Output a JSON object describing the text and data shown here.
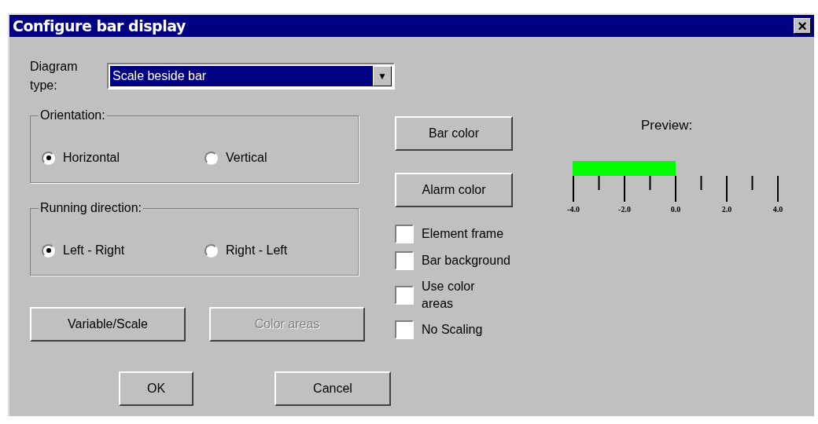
{
  "window": {
    "title": "Configure bar display",
    "close": "×"
  },
  "diagram_type": {
    "label": "Diagram type:",
    "value": "Scale beside bar",
    "arrow": "▼"
  },
  "groups": [
    {
      "title": "Orientation:",
      "options": [
        {
          "label": "Horizontal",
          "selected": true
        },
        {
          "label": "Vertical",
          "selected": false
        }
      ]
    },
    {
      "title": "Running direction:",
      "options": [
        {
          "label": "Left - Right",
          "selected": true
        },
        {
          "label": "Right - Left",
          "selected": false
        }
      ]
    }
  ],
  "left_buttons": [
    {
      "label": "Variable/Scale",
      "disabled": false
    },
    {
      "label": "Color areas",
      "disabled": true
    }
  ],
  "color_buttons": [
    "Bar color",
    "Alarm color"
  ],
  "checkboxes": [
    {
      "label": "Element frame",
      "checked": false
    },
    {
      "label": "Bar background",
      "checked": false
    },
    {
      "label": "Use color areas",
      "checked": false
    },
    {
      "label": "No Scaling",
      "checked": false
    }
  ],
  "preview": {
    "label": "Preview:",
    "level": 0.5,
    "scale_labels": [
      "-4.0",
      "-2.0",
      "0.0",
      "2.0",
      "4.0"
    ]
  },
  "footer_buttons": [
    "OK",
    "Cancel"
  ]
}
